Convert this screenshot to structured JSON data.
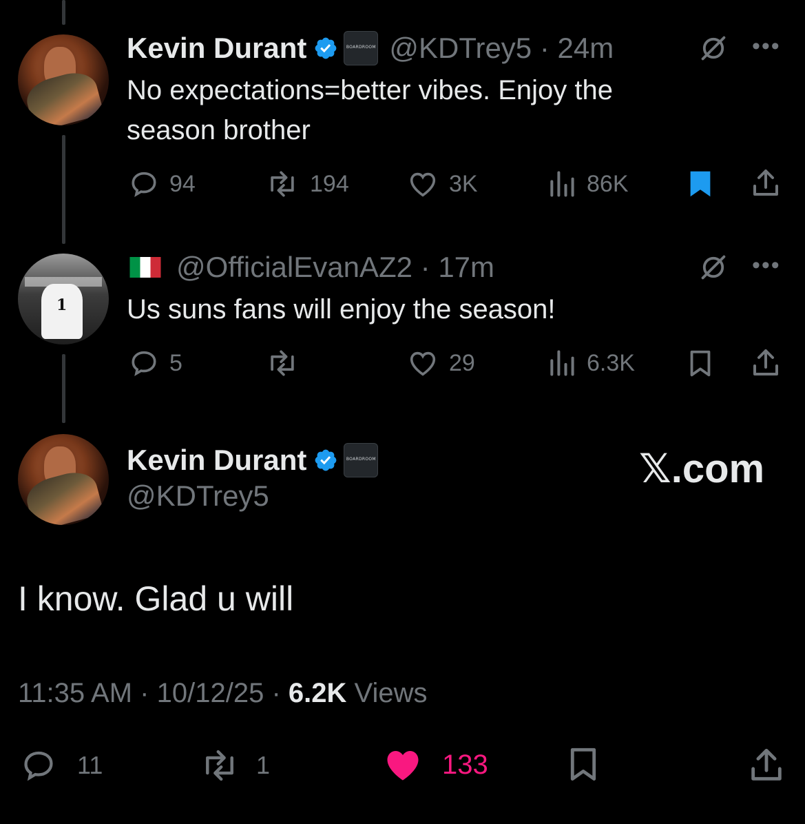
{
  "tweet1": {
    "name": "Kevin Durant",
    "badge_text": "BOARDROOM",
    "handle_time": "@KDTrey5 · 24m",
    "text": "No expectations=better vibes. Enjoy the season brother",
    "replies": "94",
    "reposts": "194",
    "likes": "3K",
    "views": "86K",
    "bookmarked": true
  },
  "tweet2": {
    "flag": "italy-flag",
    "handle_time": "@OfficialEvanAZ2 · 17m",
    "jersey_text": "1",
    "text": "Us suns fans will enjoy the season!",
    "replies": "5",
    "reposts": "",
    "likes": "29",
    "views": "6.3K",
    "bookmarked": false
  },
  "main": {
    "name": "Kevin Durant",
    "badge_text": "BOARDROOM",
    "handle": "@KDTrey5",
    "watermark": "𝕏.com",
    "text": "I know. Glad u will",
    "time": "11:35 AM",
    "date": "10/12/25",
    "views_count": "6.2K",
    "views_label": "Views",
    "replies": "11",
    "reposts": "1",
    "likes": "133",
    "liked": true
  },
  "colors": {
    "background": "#000000",
    "text": "#e7e9ea",
    "muted": "#71767b",
    "verified_blue": "#1d9bf0",
    "like_pink": "#f91880",
    "bookmark_blue": "#1d9bf0"
  }
}
